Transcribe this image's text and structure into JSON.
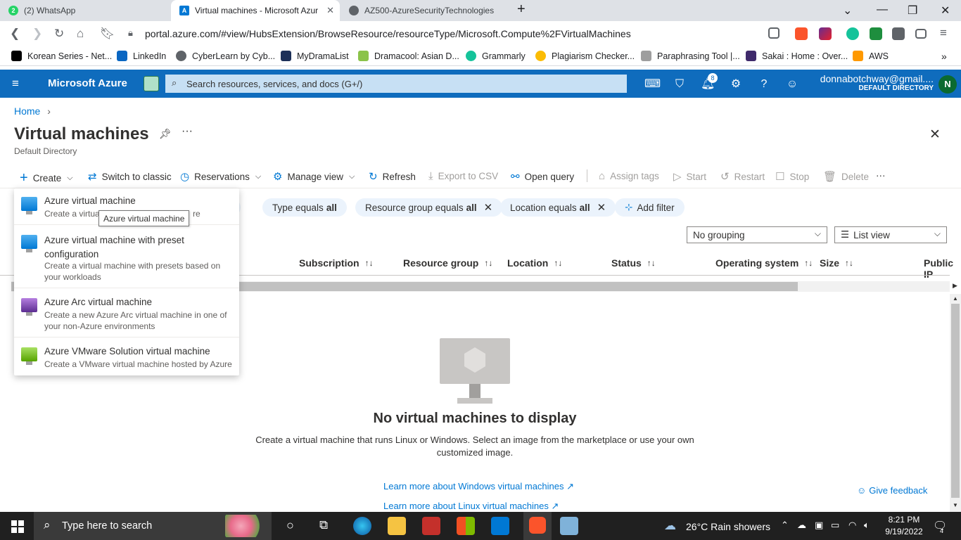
{
  "browser": {
    "tabs": [
      {
        "label": "(2) WhatsApp"
      },
      {
        "label": "Virtual machines - Microsoft Azur"
      },
      {
        "label": "AZ500-AzureSecurityTechnologies"
      }
    ],
    "url": "portal.azure.com/#view/HubsExtension/BrowseResource/resourceType/Microsoft.Compute%2FVirtualMachines",
    "bookmarks": [
      "Korean Series - Net...",
      "LinkedIn",
      "CyberLearn by Cyb...",
      "MyDramaList",
      "Dramacool: Asian D...",
      "Grammarly",
      "Plagiarism Checker...",
      "Paraphrasing Tool |...",
      "Sakai : Home : Over...",
      "AWS"
    ]
  },
  "azure": {
    "brand": "Microsoft Azure",
    "search_placeholder": "Search resources, services, and docs (G+/)",
    "notification_count": "8",
    "account_email": "donnabotchway@gmail....",
    "account_directory": "DEFAULT DIRECTORY",
    "avatar_letter": "N"
  },
  "page": {
    "breadcrumb_home": "Home",
    "title": "Virtual machines",
    "subtitle": "Default Directory"
  },
  "commands": {
    "create": "Create",
    "switch_classic": "Switch to classic",
    "reservations": "Reservations",
    "manage_view": "Manage view",
    "refresh": "Refresh",
    "export_csv": "Export to CSV",
    "open_query": "Open query",
    "assign_tags": "Assign tags",
    "start": "Start",
    "restart": "Restart",
    "stop": "Stop",
    "delete": "Delete"
  },
  "filters": {
    "type": {
      "label": "Type equals ",
      "value": "all"
    },
    "resource_group": {
      "label": "Resource group equals ",
      "value": "all"
    },
    "location": {
      "label": "Location equals ",
      "value": "all"
    },
    "add_filter": "Add filter"
  },
  "grouping": "No grouping",
  "view_mode": "List view",
  "columns": [
    "Subscription",
    "Resource group",
    "Location",
    "Status",
    "Operating system",
    "Size",
    "Public IP"
  ],
  "create_menu": [
    {
      "title": "Azure virtual machine",
      "desc": "Create a virtual machine hosted by Azure",
      "desc_visible": "Create a virtua",
      "desc_tail": "re"
    },
    {
      "title": "Azure virtual machine with preset configuration",
      "desc": "Create a virtual machine with presets based on your workloads"
    },
    {
      "title": "Azure Arc virtual machine",
      "desc": "Create a new Azure Arc virtual machine in one of your non-Azure environments"
    },
    {
      "title": "Azure VMware Solution virtual machine",
      "desc": "Create a VMware virtual machine hosted by Azure"
    }
  ],
  "tooltip": "Azure virtual machine",
  "empty_state": {
    "heading": "No virtual machines to display",
    "description": "Create a virtual machine that runs Linux or Windows. Select an image from the marketplace or use your own customized image.",
    "link_windows": "Learn more about Windows virtual machines",
    "link_linux": "Learn more about Linux virtual machines",
    "feedback": "Give feedback"
  },
  "taskbar": {
    "search_placeholder": "Type here to search",
    "weather": "26°C  Rain showers",
    "time": "8:21 PM",
    "date": "9/19/2022",
    "notifications": "4"
  }
}
